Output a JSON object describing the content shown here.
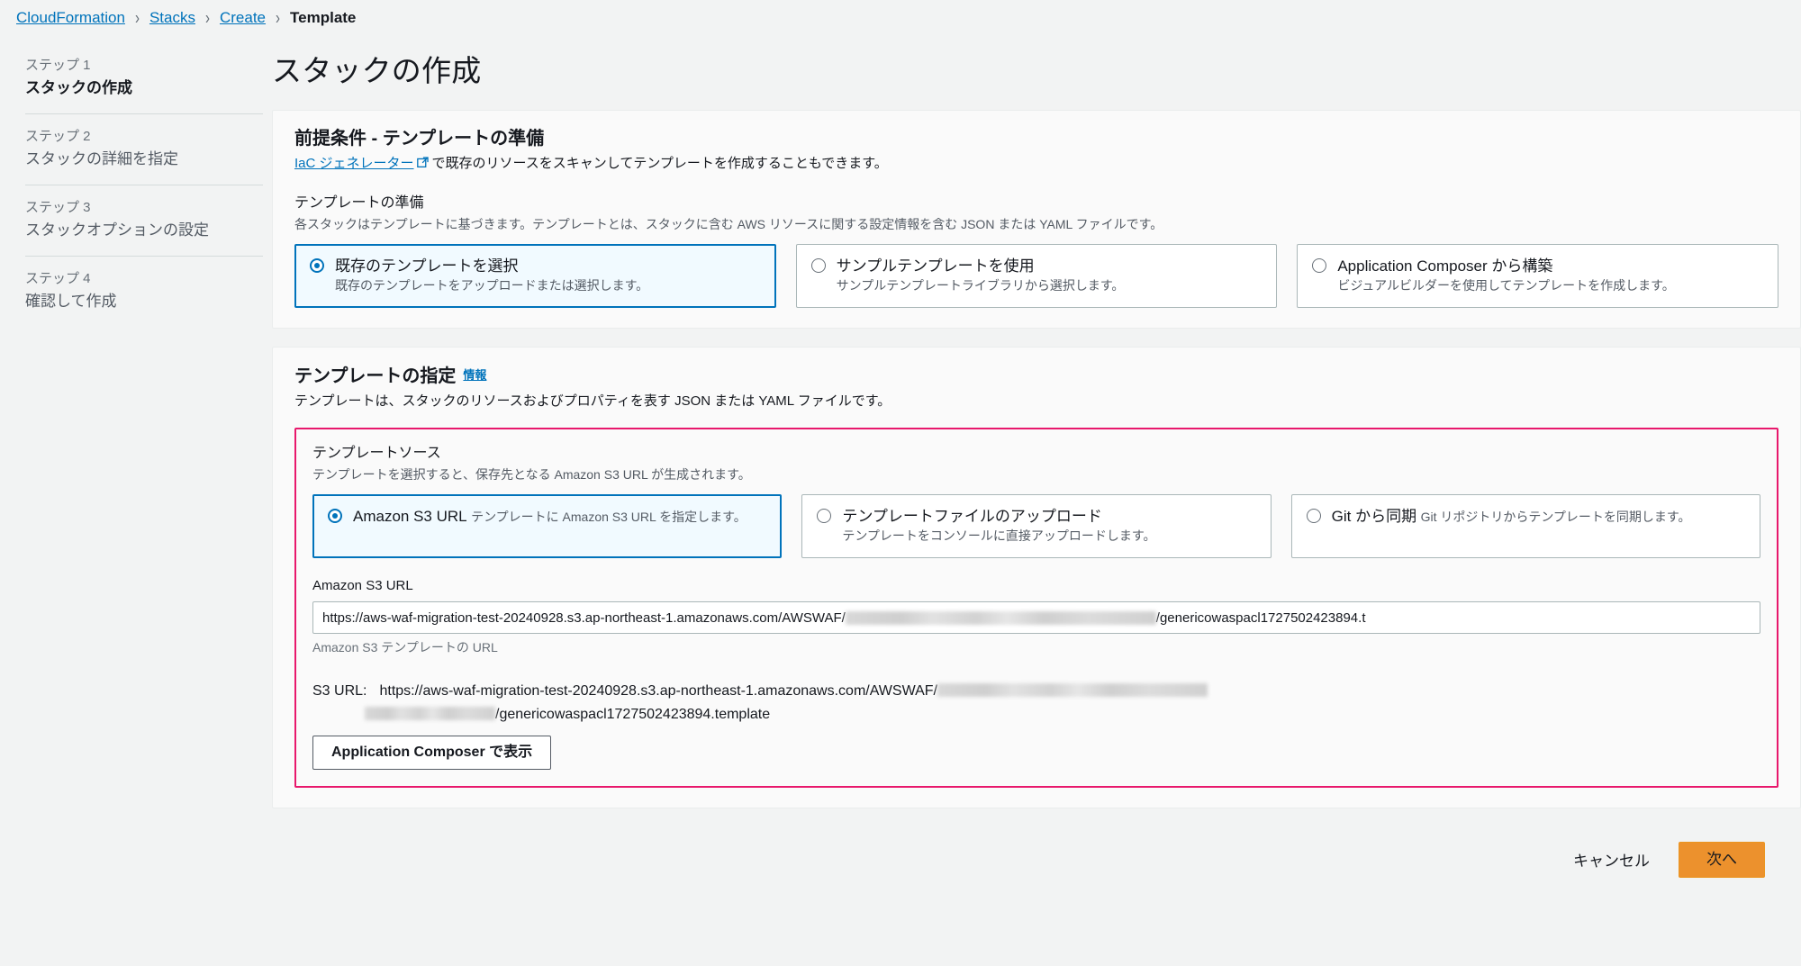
{
  "breadcrumb": {
    "items": [
      {
        "label": "CloudFormation",
        "current": false
      },
      {
        "label": "Stacks",
        "current": false
      },
      {
        "label": "Create",
        "current": false
      },
      {
        "label": "Template",
        "current": true
      }
    ],
    "separator": "›"
  },
  "sidebar": {
    "steps": [
      {
        "number": "ステップ 1",
        "title": "スタックの作成"
      },
      {
        "number": "ステップ 2",
        "title": "スタックの詳細を指定"
      },
      {
        "number": "ステップ 3",
        "title": "スタックオプションの設定"
      },
      {
        "number": "ステップ 4",
        "title": "確認して作成"
      }
    ]
  },
  "page": {
    "title": "スタックの作成"
  },
  "prerequisite_panel": {
    "title": "前提条件 - テンプレートの準備",
    "desc_link": "IaC ジェネレーター",
    "link_icon": "external-link-icon",
    "desc_rest": "で既存のリソースをスキャンしてテンプレートを作成することもできます。",
    "section_label": "テンプレートの準備",
    "section_desc": "各スタックはテンプレートに基づきます。テンプレートとは、スタックに含む AWS リソースに関する設定情報を含む JSON または YAML ファイルです。",
    "options": [
      {
        "label": "既存のテンプレートを選択",
        "desc": "既存のテンプレートをアップロードまたは選択します。",
        "selected": true
      },
      {
        "label": "サンプルテンプレートを使用",
        "desc": "サンプルテンプレートライブラリから選択します。",
        "selected": false
      },
      {
        "label": "Application Composer から構築",
        "desc": "ビジュアルビルダーを使用してテンプレートを作成します。",
        "selected": false
      }
    ]
  },
  "specify_panel": {
    "title": "テンプレートの指定",
    "info_label": "情報",
    "desc": "テンプレートは、スタックのリソースおよびプロパティを表す JSON または YAML ファイルです。",
    "source_label": "テンプレートソース",
    "source_desc": "テンプレートを選択すると、保存先となる Amazon S3 URL が生成されます。",
    "source_options": [
      {
        "label": "Amazon S3 URL",
        "desc": "テンプレートに Amazon S3 URL を指定します。",
        "selected": true
      },
      {
        "label": "テンプレートファイルのアップロード",
        "desc": "テンプレートをコンソールに直接アップロードします。",
        "selected": false
      },
      {
        "label": "Git から同期",
        "desc": "Git リポジトリからテンプレートを同期します。",
        "selected": false
      }
    ],
    "url_field_label": "Amazon S3 URL",
    "url_value_prefix": "https://aws-waf-migration-test-20240928.s3.ap-northeast-1.amazonaws.com/AWSWAF/",
    "url_value_suffix": "/genericowaspacl1727502423894.t",
    "url_hint": "Amazon S3 テンプレートの URL",
    "s3_readout_key": "S3 URL:",
    "s3_readout_prefix": "https://aws-waf-migration-test-20240928.s3.ap-northeast-1.amazonaws.com/AWSWAF/",
    "s3_readout_suffix": "/genericowaspacl1727502423894.template",
    "composer_button": "Application Composer で表示",
    "highlight_color": "#e8186c"
  },
  "footer": {
    "cancel_label": "キャンセル",
    "next_label": "次へ",
    "next_color": "#ec912d"
  }
}
